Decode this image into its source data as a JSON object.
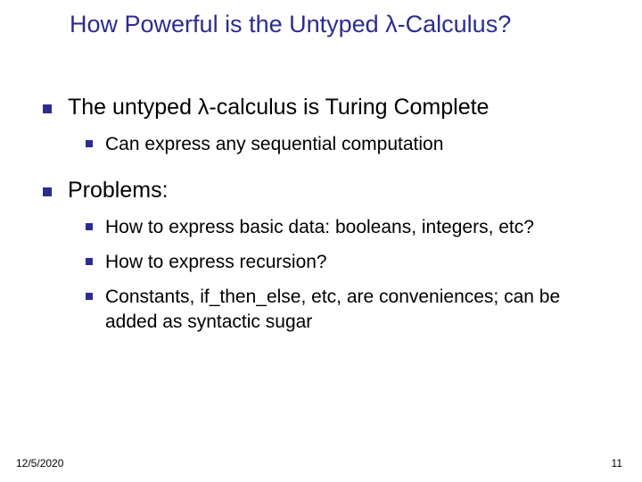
{
  "title": "How Powerful is the Untyped λ-Calculus?",
  "bullets": {
    "b1": "The untyped λ-calculus is Turing Complete",
    "b1_1": "Can express any sequential computation",
    "b2": "Problems:",
    "b2_1": "How to express basic data: booleans, integers, etc?",
    "b2_2": "How to express recursion?",
    "b2_3": "Constants, if_then_else, etc, are conveniences; can be added as syntactic sugar"
  },
  "footer": {
    "date": "12/5/2020",
    "page": "11"
  }
}
